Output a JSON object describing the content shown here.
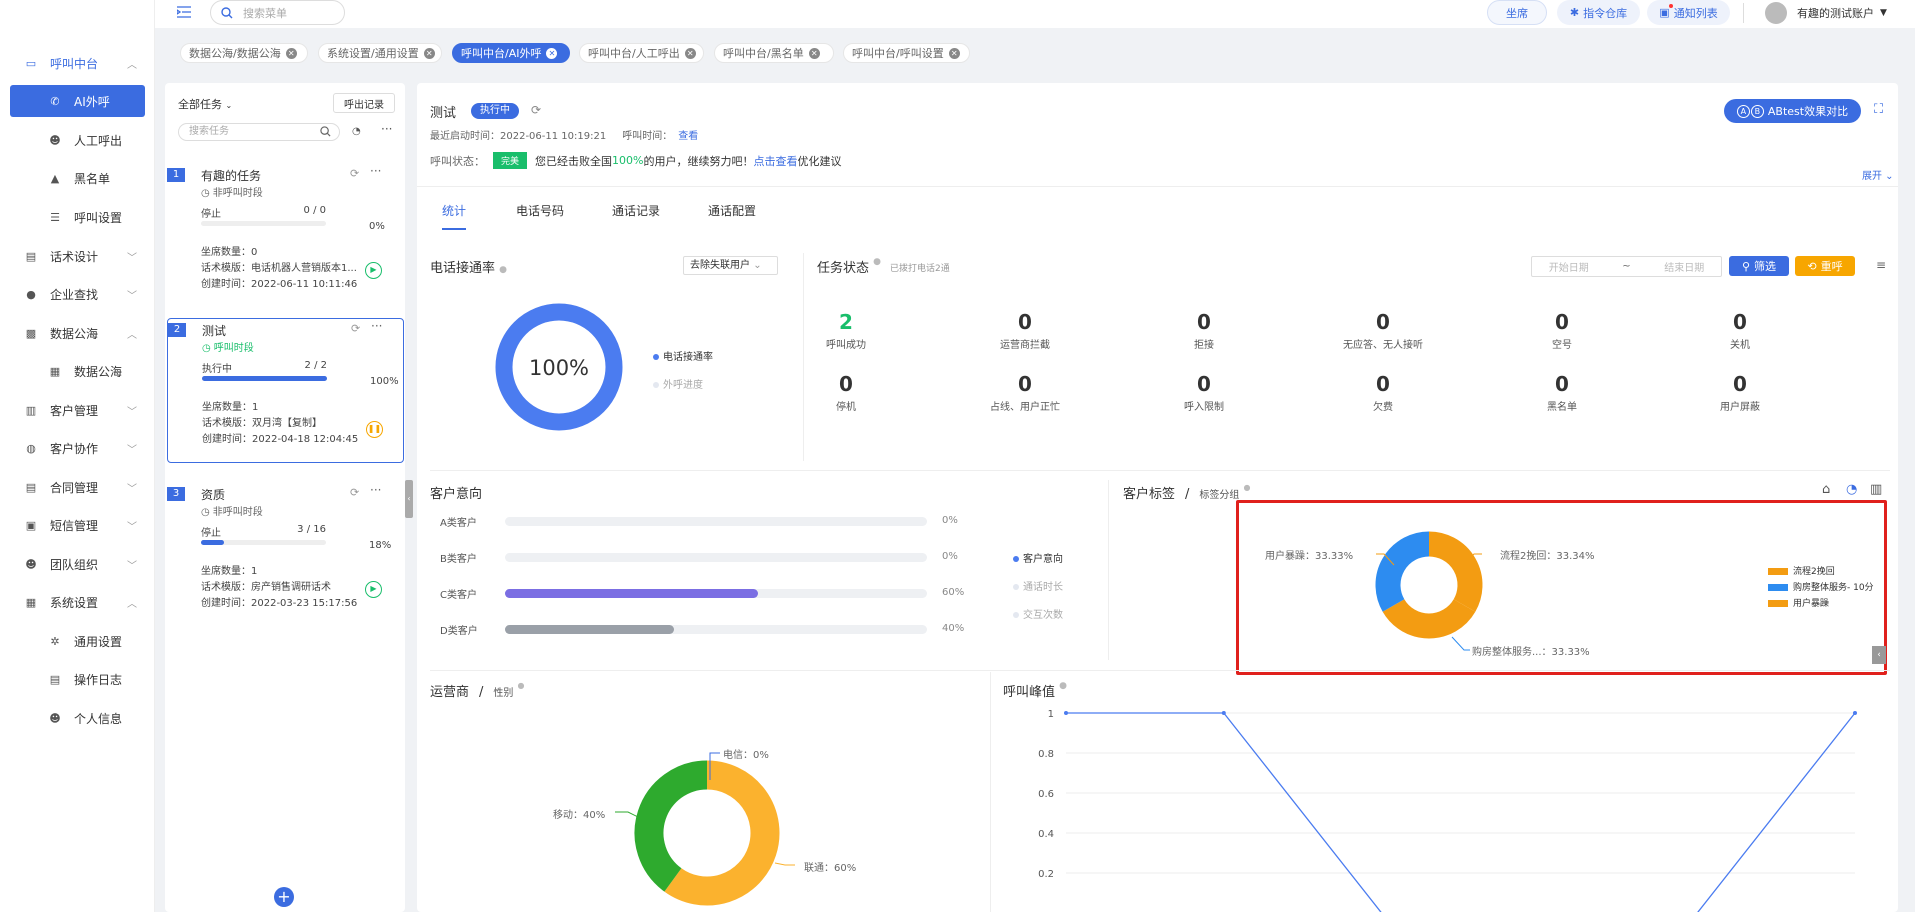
{
  "sidebar": {
    "items": [
      {
        "label": "呼叫中台",
        "icon": "monitor-icon",
        "state": "open",
        "chev": "^"
      },
      {
        "label": "AI外呼",
        "icon": "phone-icon",
        "state": "active"
      },
      {
        "label": "人工呼出",
        "icon": "user-icon",
        "state": "sub"
      },
      {
        "label": "黑名单",
        "icon": "triangle-icon",
        "state": "sub"
      },
      {
        "label": "呼叫设置",
        "icon": "sliders-icon",
        "state": "sub"
      },
      {
        "label": "话术设计",
        "icon": "book-icon",
        "chev": "v"
      },
      {
        "label": "企业查找",
        "icon": "bulb-icon",
        "chev": "v"
      },
      {
        "label": "数据公海",
        "icon": "chart-icon",
        "chev": "^"
      },
      {
        "label": "数据公海",
        "icon": "grid-icon",
        "state": "sub"
      },
      {
        "label": "客户管理",
        "icon": "id-card-icon",
        "chev": "v"
      },
      {
        "label": "客户协作",
        "icon": "team-icon",
        "chev": "v"
      },
      {
        "label": "合同管理",
        "icon": "contract-icon",
        "chev": "v"
      },
      {
        "label": "短信管理",
        "icon": "message-icon",
        "chev": "v"
      },
      {
        "label": "团队组织",
        "icon": "org-icon",
        "chev": "v"
      },
      {
        "label": "系统设置",
        "icon": "settings-icon",
        "chev": "^"
      },
      {
        "label": "通用设置",
        "icon": "gear-icon",
        "state": "sub"
      },
      {
        "label": "操作日志",
        "icon": "log-icon",
        "state": "sub"
      },
      {
        "label": "个人信息",
        "icon": "person-icon",
        "state": "sub"
      }
    ]
  },
  "topbar": {
    "search_placeholder": "搜索菜单",
    "btn_seat": "坐席",
    "btn_commands": "指令仓库",
    "btn_notify": "通知列表",
    "account": "有趣的测试账户"
  },
  "tabs": [
    {
      "label": "数据公海/数据公海"
    },
    {
      "label": "系统设置/通用设置"
    },
    {
      "label": "呼叫中台/AI外呼",
      "active": true
    },
    {
      "label": "呼叫中台/人工呼出"
    },
    {
      "label": "呼叫中台/黑名单"
    },
    {
      "label": "呼叫中台/呼叫设置"
    }
  ],
  "tasks_panel": {
    "filter": "全部任务",
    "records_btn": "呼出记录",
    "search_placeholder": "搜索任务",
    "tasks": [
      {
        "num": "1",
        "name": "有趣的任务",
        "period": "非呼叫时段",
        "status": "停止",
        "count": "0 / 0",
        "pct": "0%",
        "progress": 0,
        "seats": "坐席数量：0",
        "template": "话术模版：电话机器人营销版本1...",
        "created": "创建时间：2022-06-11 10:11:46",
        "action": "play"
      },
      {
        "num": "2",
        "name": "测试",
        "period": "呼叫时段",
        "status": "执行中",
        "count": "2 / 2",
        "pct": "100%",
        "progress": 100,
        "seats": "坐席数量：1",
        "template": "话术模版：双月湾【复制】",
        "created": "创建时间：2022-04-18 12:04:45",
        "action": "pause"
      },
      {
        "num": "3",
        "name": "资质",
        "period": "非呼叫时段",
        "status": "停止",
        "count": "3 / 16",
        "pct": "18%",
        "progress": 18,
        "seats": "坐席数量：1",
        "template": "话术模版：房产销售调研话术",
        "created": "创建时间：2022-03-23 15:17:56",
        "action": "play"
      }
    ]
  },
  "detail": {
    "title": "测试",
    "status_badge": "执行中",
    "last_start": "最近启动时间：2022-06-11 10:19:21",
    "call_time_label": "呼叫时间：",
    "call_time_link": "查看",
    "call_status_label": "呼叫状态：",
    "call_status_badge": "完美",
    "call_status_text_a": "您已经击败全国",
    "call_status_pct": "100%",
    "call_status_text_b": "的用户，继续努力吧！",
    "call_status_link": "点击查看",
    "call_status_text_c": "优化建议",
    "ab_btn": "ABtest效果对比",
    "expand": "展开",
    "subtabs": [
      "统计",
      "电话号码",
      "通话记录",
      "通话配置"
    ]
  },
  "connect_rate": {
    "title": "电话接通率",
    "filter": "去除失联用户",
    "value_label": "100%",
    "value": 100,
    "legend": [
      "电话接通率",
      "外呼进度"
    ]
  },
  "task_status": {
    "title": "任务状态",
    "note": "已拨打电话2通",
    "start_ph": "开始日期",
    "sep": "~",
    "end_ph": "结束日期",
    "filter_btn": "筛选",
    "recall_btn": "重呼",
    "stats": [
      {
        "v": "2",
        "l": "呼叫成功",
        "hl": true
      },
      {
        "v": "0",
        "l": "运营商拦截"
      },
      {
        "v": "0",
        "l": "拒接"
      },
      {
        "v": "0",
        "l": "无应答、无人接听"
      },
      {
        "v": "0",
        "l": "空号"
      },
      {
        "v": "0",
        "l": "关机"
      },
      {
        "v": "0",
        "l": "停机"
      },
      {
        "v": "0",
        "l": "占线、用户正忙"
      },
      {
        "v": "0",
        "l": "呼入限制"
      },
      {
        "v": "0",
        "l": "欠费"
      },
      {
        "v": "0",
        "l": "黑名单"
      },
      {
        "v": "0",
        "l": "用户屏蔽"
      }
    ]
  },
  "intent": {
    "title": "客户意向",
    "rows": [
      {
        "label": "A类客户",
        "value": 0,
        "pct": "0%",
        "color": "#dfe3ea"
      },
      {
        "label": "B类客户",
        "value": 0,
        "pct": "0%",
        "color": "#dfe3ea"
      },
      {
        "label": "C类客户",
        "value": 60,
        "pct": "60%",
        "color": "#7b6ee3"
      },
      {
        "label": "D类客户",
        "value": 40,
        "pct": "40%",
        "color": "#9aa0a8"
      }
    ],
    "legend": [
      "客户意向",
      "通话时长",
      "交互次数"
    ]
  },
  "tags": {
    "title": "客户标签",
    "sep": "/",
    "subtitle": "标签分组",
    "slices": [
      {
        "label": "用户暴躁：33.33%",
        "value": 33.33,
        "color": "#f39c12"
      },
      {
        "label": "流程2挽回：33.34%",
        "value": 33.34,
        "color": "#f39c12"
      },
      {
        "label": "购房整体服务...：33.33%",
        "value": 33.33,
        "color": "#2d8cf0"
      }
    ],
    "legend": [
      {
        "label": "流程2挽回",
        "color": "#f39c12"
      },
      {
        "label": "购房整体服务- 10分",
        "color": "#2d8cf0"
      },
      {
        "label": "用户暴躁",
        "color": "#f39c12"
      }
    ],
    "highlight_color": "#e0201c"
  },
  "carrier": {
    "title": "运营商",
    "sep": "/",
    "subtitle": "性别",
    "slices": [
      {
        "label": "电信：0%",
        "value": 0,
        "color": "#3b6ce0"
      },
      {
        "label": "联通：60%",
        "value": 60,
        "color": "#fbb22e"
      },
      {
        "label": "移动：40%",
        "value": 40,
        "color": "#2eaa2e"
      }
    ]
  },
  "peak": {
    "title": "呼叫峰值",
    "yticks": [
      "1",
      "0.8",
      "0.6",
      "0.4",
      "0.2"
    ]
  },
  "chart_data": [
    {
      "type": "pie",
      "title": "电话接通率",
      "categories": [
        "电话接通率"
      ],
      "values": [
        100
      ]
    },
    {
      "type": "bar",
      "title": "客户意向",
      "categories": [
        "A类客户",
        "B类客户",
        "C类客户",
        "D类客户"
      ],
      "values": [
        0,
        0,
        60,
        40
      ],
      "ylim": [
        0,
        100
      ]
    },
    {
      "type": "pie",
      "title": "客户标签",
      "categories": [
        "用户暴躁",
        "流程2挽回",
        "购房整体服务..."
      ],
      "values": [
        33.33,
        33.34,
        33.33
      ]
    },
    {
      "type": "pie",
      "title": "运营商",
      "categories": [
        "电信",
        "联通",
        "移动"
      ],
      "values": [
        0,
        60,
        40
      ]
    },
    {
      "type": "line",
      "title": "呼叫峰值",
      "x": [
        0,
        1,
        2,
        3,
        4,
        5
      ],
      "series": [
        {
          "values": [
            1,
            1,
            0,
            0,
            0,
            1
          ]
        }
      ],
      "ylim": [
        0,
        1
      ]
    }
  ]
}
